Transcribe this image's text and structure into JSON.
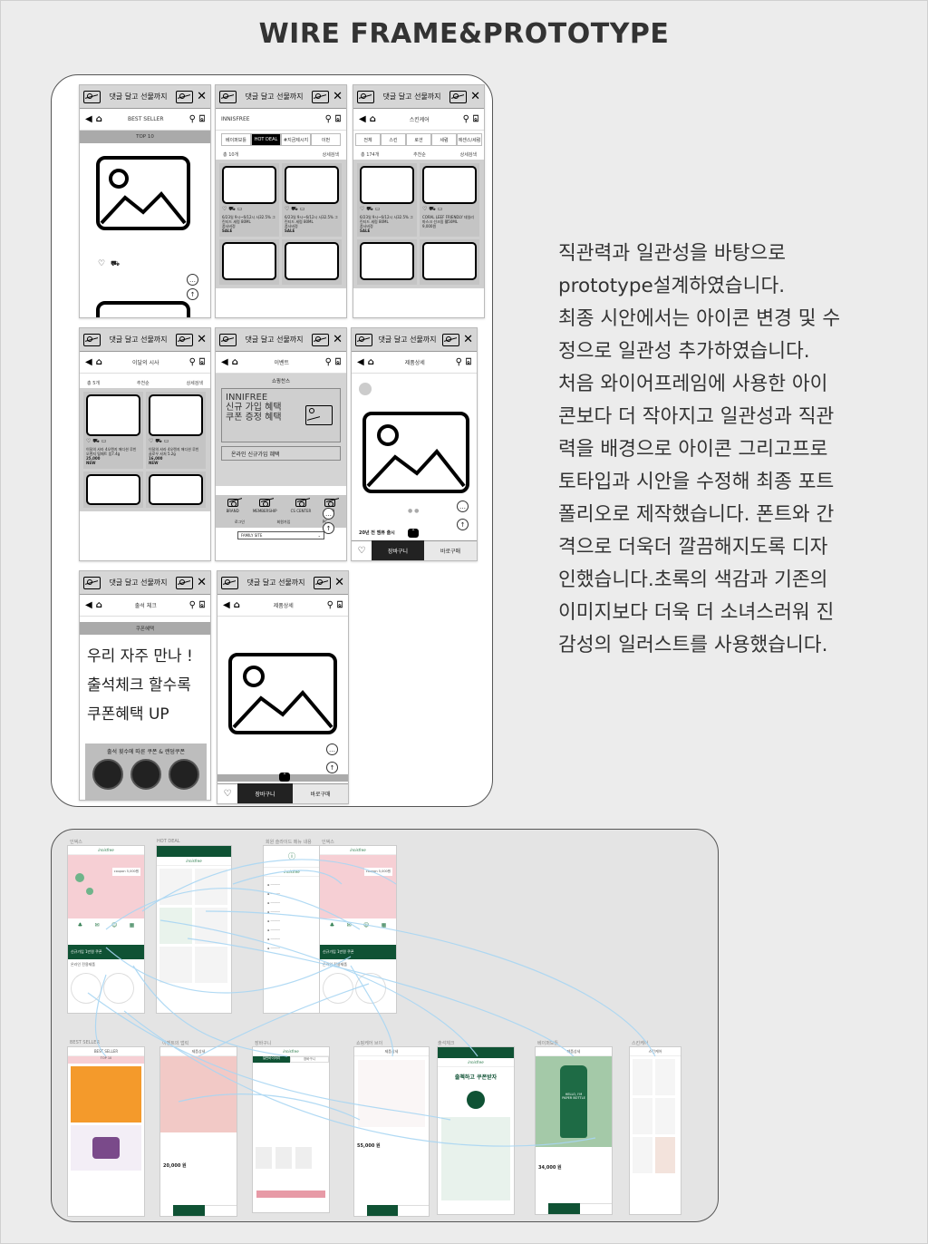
{
  "page": {
    "title": "WIRE FRAME&PROTOTYPE"
  },
  "colors": {
    "accent_green": "#0f5234",
    "pink": "#f6cfd4",
    "link_blue": "#a9d6f3",
    "wire_gray": "#c4c4c4"
  },
  "wireframe": {
    "ad_text": "댓글 달고 선물까지",
    "screens": [
      {
        "title": "BEST SELLER",
        "subbar": "TOP 10"
      },
      {
        "title": "INNISFREE",
        "tabs": [
          "베이퍼보틀",
          "HOT DEAL",
          "#지금제시지",
          "이번"
        ],
        "count": "총 10개",
        "sort": "상세검색",
        "cells": [
          {
            "desc": "6/23일 9시~6/12시 사32.5% 그린티드 세럼 80ML",
            "tag": "품사비정",
            "flag": "SALE"
          },
          {
            "desc": "6/23일 9시~6/12시 사32.5% 그린티드 세럼 80ML",
            "tag": "품사비정",
            "flag": "SALE"
          }
        ]
      },
      {
        "title": "스킨케어",
        "tabs": [
          "전체",
          "스킨",
          "로션",
          "세럼",
          "에센스/세럼"
        ],
        "count": "총 174개",
        "sort_a": "추천순",
        "sort": "상세검색",
        "cells": [
          {
            "desc": "6/23일 9시~6/12시 사32.5% 그린티드 세럼 80ML",
            "tag": "품사비정",
            "flag": "SALE"
          },
          {
            "desc": "CORAL LEEF FRIENDLY 데일리 마스크 선크림 웰50ML",
            "tag": "9,000원",
            "flag": ""
          }
        ]
      },
      {
        "title": "이달의 시사",
        "count": "총 5개",
        "sort_a": "추천순",
        "sort": "상세검색",
        "cells": [
          {
            "desc": "이달의 샤라 4오렌지 애디션 루빈 오렌지 털페트 립7.4g",
            "price": "25,000",
            "flag": "NEW"
          },
          {
            "desc": "이달의 샤라 4오렌지 애디션 루빈 골로우 샤처 5.2g",
            "price": "16,000",
            "flag": "NEW"
          }
        ]
      },
      {
        "title": "이벤트",
        "subbar": "쇼핑찬스",
        "banner": [
          "INNIFREE",
          "신규 가입 혜택",
          "쿠폰 증정 혜택"
        ],
        "banner_sub": "온라인 신규가입 혜택",
        "icons": [
          "BRAND",
          "MEMBERSHIP",
          "CS CENTER",
          "FIND"
        ],
        "links": [
          "로그인",
          "회원가입",
          "PC"
        ],
        "family": "FAMILY SITE"
      },
      {
        "title": "제품상세",
        "badge": "20년 전 멤퓨 출시",
        "cart": "장바구니",
        "buy": "바로구매"
      },
      {
        "title": "출석 체크",
        "subbar": "쿠폰혜택",
        "headline": [
          "우리 자주 만나 !",
          "출석체크 할수록",
          "쿠폰혜택 UP"
        ],
        "footer": "출석 횟수에 따른 쿠폰 & 랜덤쿠폰"
      },
      {
        "title": "제품상세",
        "cart": "장바구니",
        "buy": "바로구매"
      }
    ]
  },
  "description": [
    "직관력과 일관성을 바탕으로",
    "prototype설계하였습니다.",
    "최종 시안에서는 아이콘 변경 및 수",
    "정으로 일관성 추가하였습니다.",
    "처음 와이어프레임에 사용한 아이",
    "콘보다 더 작아지고 일관성과 직관",
    "력을 배경으로 아이콘 그리고프로",
    "토타입과 시안을 수정해 최종 포트",
    "폴리오로 제작했습니다. 폰트와 간",
    "격으로 더욱더 깔끔해지도록 디자",
    "인했습니다.초록의 색감과 기존의",
    "이미지보다 더욱 더 소녀스러워 진",
    "감성의 일러스트를 사용했습니다."
  ],
  "prototype": {
    "brand": "innisfree",
    "labels": [
      "인덱스",
      "HOT DEAL",
      "회원 슬라이드 메뉴 내용",
      "인덱스",
      "BEST SELLER",
      "이벤트의 앱릭",
      "장바구니",
      "쇼핑케어 브이",
      "출석체크",
      "베이퍼보틀",
      "스킨케어"
    ],
    "screen_texts": {
      "best": "BEST SELLER",
      "top": "TOP 10",
      "detail": "제품상세",
      "cart_tabs": [
        "일반바이어리",
        "장바구니"
      ],
      "attendance": "출첵하고 쿠폰받자",
      "bottle": "HELLO, I'M PAPER BOTTLE",
      "price_a": "20,000 원",
      "price_b": "55,000 원",
      "price_c": "34,000 원",
      "signup": "신규가입 1만원 쿠폰",
      "coupon": "coupon 5,000원",
      "beauty": "온라인 전용제품"
    }
  }
}
